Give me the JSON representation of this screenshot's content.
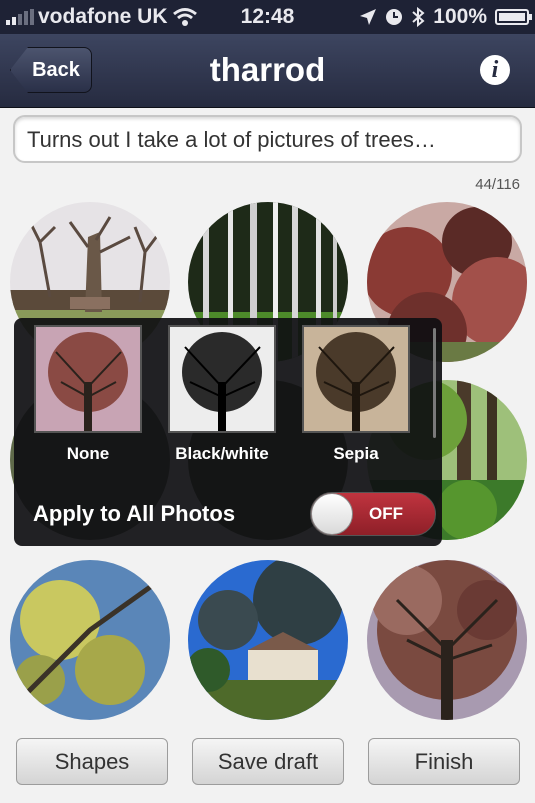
{
  "status_bar": {
    "carrier": "vodafone UK",
    "time": "12:48",
    "battery": "100%",
    "icons": [
      "signal-icon",
      "wifi-icon",
      "location-icon",
      "alarm-icon",
      "bluetooth-icon",
      "battery-icon"
    ]
  },
  "navbar": {
    "back_label": "Back",
    "title": "tharrod",
    "info_icon": "info-icon"
  },
  "caption": {
    "value": "Turns out I take a lot of pictures of trees…",
    "counter": "44/116"
  },
  "filter_popup": {
    "filters": [
      {
        "label": "None",
        "style": "none"
      },
      {
        "label": "Black/white",
        "style": "bw"
      },
      {
        "label": "Sepia",
        "style": "sepia"
      }
    ],
    "apply_all_label": "Apply to All Photos",
    "toggle_state": "OFF"
  },
  "photos": [
    {
      "name": "pollarded-trees-photo"
    },
    {
      "name": "birch-forest-photo"
    },
    {
      "name": "red-maple-photo"
    },
    {
      "name": "hidden-photo-1"
    },
    {
      "name": "hidden-photo-2"
    },
    {
      "name": "green-woodland-photo"
    },
    {
      "name": "yellow-leaves-photo"
    },
    {
      "name": "cedar-house-photo"
    },
    {
      "name": "tree-canopy-photo"
    }
  ],
  "buttons": {
    "shapes": "Shapes",
    "save_draft": "Save draft",
    "finish": "Finish"
  },
  "colors": {
    "navbar": "#2e344b",
    "toggle_off": "#b02a35",
    "background": "#f2f2f2"
  }
}
